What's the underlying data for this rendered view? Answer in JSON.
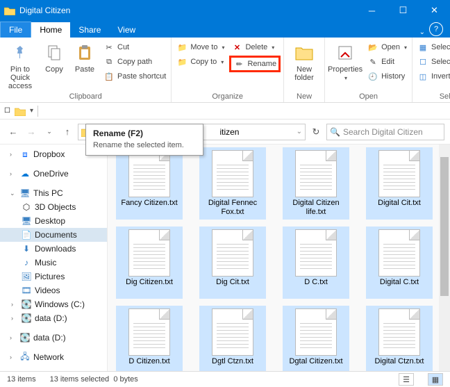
{
  "window": {
    "title": "Digital Citizen"
  },
  "tabs": {
    "file": "File",
    "home": "Home",
    "share": "Share",
    "view": "View"
  },
  "ribbon": {
    "clipboard": {
      "label": "Clipboard",
      "pin": "Pin to Quick access",
      "copy": "Copy",
      "paste": "Paste",
      "cut": "Cut",
      "copypath": "Copy path",
      "pasteshortcut": "Paste shortcut"
    },
    "organize": {
      "label": "Organize",
      "moveto": "Move to",
      "copyto": "Copy to",
      "delete": "Delete",
      "rename": "Rename"
    },
    "new": {
      "label": "New",
      "newfolder": "New folder"
    },
    "open": {
      "label": "Open",
      "properties": "Properties",
      "open": "Open",
      "edit": "Edit",
      "history": "History"
    },
    "select": {
      "label": "Select",
      "all": "Select all",
      "none": "Select none",
      "invert": "Invert selection"
    }
  },
  "tooltip": {
    "title": "Rename (F2)",
    "desc": "Rename the selected item."
  },
  "nav": {
    "crumb_tail": "itizen",
    "search_placeholder": "Search Digital Citizen"
  },
  "sidebar": {
    "dropbox": "Dropbox",
    "onedrive": "OneDrive",
    "thispc": "This PC",
    "objects3d": "3D Objects",
    "desktop": "Desktop",
    "documents": "Documents",
    "downloads": "Downloads",
    "music": "Music",
    "pictures": "Pictures",
    "videos": "Videos",
    "cdrive": "Windows (C:)",
    "ddrive": "data (D:)",
    "ddrive2": "data (D:)",
    "network": "Network"
  },
  "files": [
    "Fancy Citizen.txt",
    "Digital Fennec Fox.txt",
    "Digital Citizen life.txt",
    "Digital Cit.txt",
    "Dig Citizen.txt",
    "Dig Cit.txt",
    "D C.txt",
    "Digital C.txt",
    "D Citizen.txt",
    "Dgtl Ctzn.txt",
    "Dgtal Citizen.txt",
    "Digital Ctzn.txt"
  ],
  "status": {
    "count": "13 items",
    "selected": "13 items selected",
    "size": "0 bytes"
  }
}
